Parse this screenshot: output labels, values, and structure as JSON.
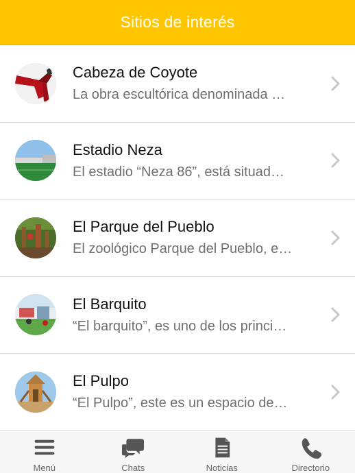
{
  "header": {
    "title": "Sitios de interés"
  },
  "colors": {
    "header": "#ffc600",
    "tab_icon": "#555555",
    "chevron": "#c7c7cc"
  },
  "items": [
    {
      "title": "Cabeza de Coyote",
      "desc": "La obra escultórica denominada …",
      "image": "coyote-sculpture"
    },
    {
      "title": "Estadio Neza",
      "desc": "El estadio “Neza 86”, está situad…",
      "image": "stadium"
    },
    {
      "title": "El Parque del Pueblo",
      "desc": "El zoológico Parque del Pueblo, e…",
      "image": "park"
    },
    {
      "title": "El Barquito",
      "desc": "“El barquito”, es uno de los princi…",
      "image": "boat-park"
    },
    {
      "title": "El Pulpo",
      "desc": "“El Pulpo”, este es un espacio de…",
      "image": "playground"
    }
  ],
  "tabs": [
    {
      "label": "Menú",
      "icon": "menu-icon"
    },
    {
      "label": "Chats",
      "icon": "chat-icon"
    },
    {
      "label": "Noticias",
      "icon": "document-icon"
    },
    {
      "label": "Directorio",
      "icon": "phone-icon"
    }
  ]
}
